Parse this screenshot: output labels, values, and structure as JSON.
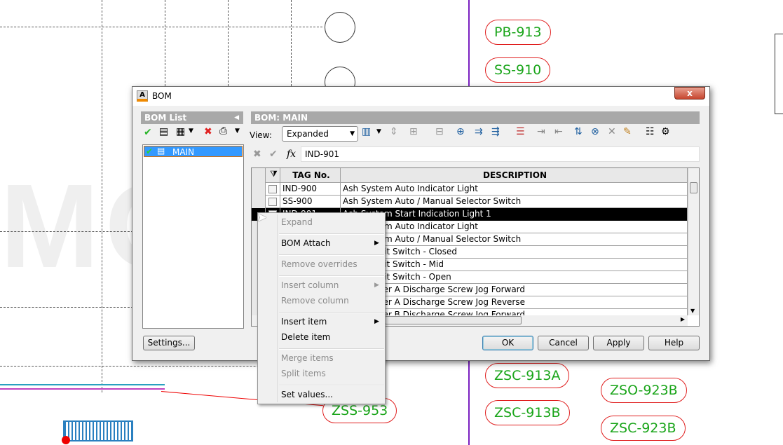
{
  "background": {
    "watermark": "MOVERSI",
    "cad_labels": [
      "PB-913",
      "SS-910",
      "ZSC-913A",
      "ZSO-923B",
      "ZSC-913B",
      "ZSC-923B",
      "ZSS-953"
    ]
  },
  "dialog": {
    "title": "BOM",
    "close_label": "x",
    "bom_list": {
      "header": "BOM List",
      "items": [
        {
          "label": "MAIN"
        }
      ]
    },
    "bom_panel": {
      "header": "BOM: MAIN",
      "view_label": "View:",
      "view_value": "Expanded",
      "formula_value": "IND-901",
      "columns": [
        "TAG No.",
        "DESCRIPTION"
      ],
      "rows": [
        {
          "tag": "IND-900",
          "description": "Ash System Auto Indicator Light"
        },
        {
          "tag": "SS-900",
          "description": "Ash System Auto / Manual Selector Switch"
        },
        {
          "tag": "IND-901",
          "description": "Ash System Start Indication Light 1",
          "selected": true
        },
        {
          "tag": "",
          "description": "Ash System Auto Indicator Light"
        },
        {
          "tag": "",
          "description": "Ash System Auto / Manual Selector Switch"
        },
        {
          "tag": "",
          "description": "Grate Limit Switch - Closed"
        },
        {
          "tag": "",
          "description": "Grate Limit Switch - Mid"
        },
        {
          "tag": "",
          "description": "Grate Limit Switch - Open"
        },
        {
          "tag": "",
          "description": "Ash Hopper A Discharge Screw Jog Forward"
        },
        {
          "tag": "",
          "description": "Ash Hopper A Discharge Screw Jog Reverse"
        },
        {
          "tag": "",
          "description": "Ash Hopper B Discharge Screw Jog Forward"
        }
      ]
    },
    "buttons": {
      "settings": "Settings...",
      "ok": "OK",
      "cancel": "Cancel",
      "apply": "Apply",
      "help": "Help"
    }
  },
  "context_menu": {
    "items": [
      {
        "label": "Expand",
        "disabled": true
      },
      {
        "label": "BOM Attach",
        "submenu": true
      },
      {
        "label": "Remove overrides",
        "disabled": true
      },
      {
        "label": "Insert column",
        "disabled": true,
        "submenu": true
      },
      {
        "label": "Remove column",
        "disabled": true
      },
      {
        "label": "Insert item",
        "submenu": true
      },
      {
        "label": "Delete item"
      },
      {
        "label": "Merge items",
        "disabled": true
      },
      {
        "label": "Split items",
        "disabled": true
      },
      {
        "label": "Set values..."
      }
    ]
  },
  "colors": {
    "selection": "#3399ff",
    "cad_text": "#1aa51a",
    "cad_outline": "#e02020",
    "purple_line": "#7a20c0"
  }
}
